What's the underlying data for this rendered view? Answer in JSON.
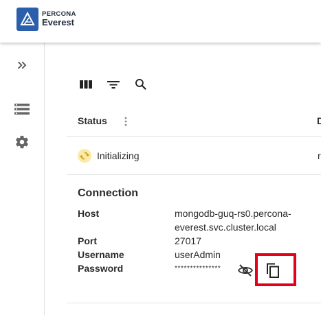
{
  "brand": {
    "line1": "PERCONA",
    "line2": "Everest"
  },
  "sidebar": {
    "items": [
      {
        "icon": "chevrons-right-icon"
      },
      {
        "icon": "database-list-icon"
      },
      {
        "icon": "gear-icon"
      }
    ]
  },
  "toolbar": {
    "icons": [
      "columns-icon",
      "filter-icon",
      "search-icon"
    ]
  },
  "table": {
    "columns": [
      "Status",
      "D"
    ],
    "row": {
      "status": "Initializing",
      "next_col_fragment": "r"
    }
  },
  "connection": {
    "title": "Connection",
    "host_label": "Host",
    "host_line1": "mongodb-guq-rs0.percona-",
    "host_line2": "everest.svc.cluster.local",
    "port_label": "Port",
    "port_value": "27017",
    "username_label": "Username",
    "username_value": "userAdmin",
    "password_label": "Password",
    "password_value": "***************"
  },
  "colors": {
    "brand": "#2b5fab",
    "highlight": "#e2001a",
    "status_bg": "#fbe9a6",
    "status_fg": "#c9a015"
  }
}
